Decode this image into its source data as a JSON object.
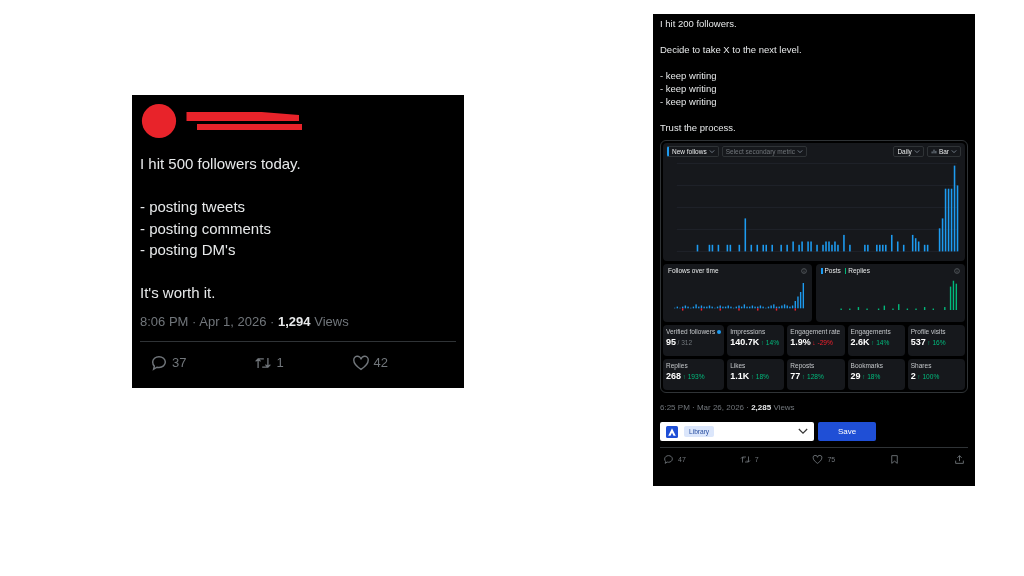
{
  "left_post": {
    "paragraphs": [
      [
        "I hit 500 followers today."
      ],
      [
        "- posting tweets",
        "- posting comments",
        "- posting DM's"
      ],
      [
        "It's worth it."
      ]
    ],
    "meta": "8:06 PM · Apr 1, 2026 · **1,294** Views",
    "actions": [
      {
        "kind": "reply",
        "count": "37"
      },
      {
        "kind": "repost",
        "count": "1"
      },
      {
        "kind": "like",
        "count": "42"
      }
    ]
  },
  "right_post": {
    "paragraphs": [
      [
        "I hit 200 followers."
      ],
      [
        "Decide to take X to the next level."
      ],
      [
        "- keep writing",
        "- keep writing",
        "- keep writing"
      ],
      [
        "Trust the process."
      ]
    ],
    "analytics": {
      "primary_metric": "New follows",
      "secondary_placeholder": "Select secondary metric",
      "interval": "Daily",
      "chart_type": "Bar",
      "follows_title": "Follows over time",
      "legend": [
        {
          "label": "Posts",
          "color": "#1d9bf0"
        },
        {
          "label": "Replies",
          "color": "#00ba7c"
        }
      ],
      "metrics": [
        {
          "label": "Verified followers",
          "value": "95",
          "sub": "/ 312",
          "verified": true
        },
        {
          "label": "Impressions",
          "value": "140.7K",
          "delta": "↑ 14%",
          "negative": false
        },
        {
          "label": "Engagement rate",
          "value": "1.9%",
          "delta": "↓ -29%",
          "negative": true
        },
        {
          "label": "Engagements",
          "value": "2.6K",
          "delta": "↑ 14%",
          "negative": false
        },
        {
          "label": "Profile visits",
          "value": "537",
          "delta": "↑ 16%",
          "negative": false
        },
        {
          "label": "Replies",
          "value": "268",
          "delta": "↑ 193%",
          "negative": false
        },
        {
          "label": "Likes",
          "value": "1.1K",
          "delta": "↑ 18%",
          "negative": false
        },
        {
          "label": "Reposts",
          "value": "77",
          "delta": "↑ 128%",
          "negative": false
        },
        {
          "label": "Bookmarks",
          "value": "29",
          "delta": "↑ 18%",
          "negative": false
        },
        {
          "label": "Shares",
          "value": "2",
          "delta": "↑ 100%",
          "negative": false
        }
      ]
    },
    "meta": "6:25 PM · Mar 26, 2026 · **2,285** Views",
    "library": {
      "tag": "Library",
      "button": "Save"
    },
    "actions": [
      {
        "kind": "reply",
        "count": "47"
      },
      {
        "kind": "repost",
        "count": "7"
      },
      {
        "kind": "like",
        "count": "75"
      },
      {
        "kind": "bookmark"
      },
      {
        "kind": "share"
      }
    ]
  }
}
